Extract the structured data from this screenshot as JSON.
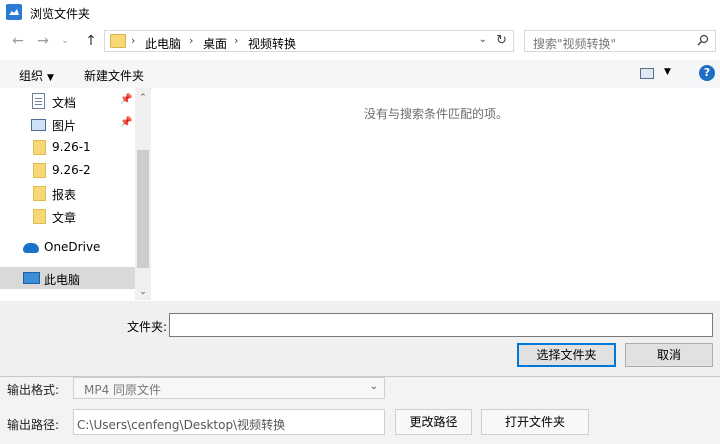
{
  "dialog": {
    "title": "浏览文件夹",
    "breadcrumbs": [
      "此电脑",
      "桌面",
      "视频转换"
    ],
    "search_placeholder": "搜索\"视频转换\"",
    "toolbar": {
      "organize": "组织",
      "new_folder": "新建文件夹"
    },
    "nav_items": [
      {
        "label": "文档",
        "icon": "document-icon",
        "pinned": true
      },
      {
        "label": "图片",
        "icon": "pictures-icon",
        "pinned": true
      },
      {
        "label": "9.26-1",
        "icon": "folder-icon"
      },
      {
        "label": "9.26-2",
        "icon": "folder-icon"
      },
      {
        "label": "报表",
        "icon": "folder-icon"
      },
      {
        "label": "文章",
        "icon": "folder-icon"
      },
      {
        "label": "OneDrive",
        "icon": "onedrive-icon"
      },
      {
        "label": "此电脑",
        "icon": "computer-icon",
        "selected": true
      }
    ],
    "empty_message": "没有与搜索条件匹配的项。",
    "folder_label": "文件夹:",
    "folder_value": "",
    "select_button": "选择文件夹",
    "cancel_button": "取消"
  },
  "app": {
    "format_label": "输出格式:",
    "format_value": "MP4  同原文件",
    "path_label": "输出路径:",
    "path_value": "C:\\Users\\cenfeng\\Desktop\\视频转换",
    "change_path_button": "更改路径",
    "open_folder_button": "打开文件夹"
  }
}
